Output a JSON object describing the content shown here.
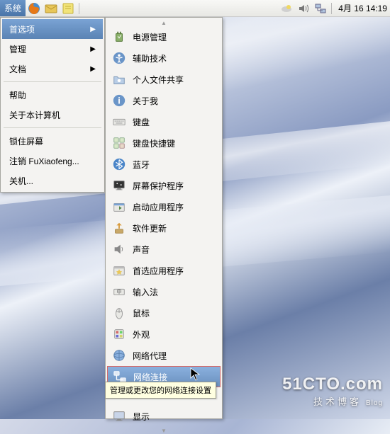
{
  "panel": {
    "system_label": "系统",
    "clock": "4月 16 14:19"
  },
  "system_menu": {
    "preferences": "首选项",
    "administration": "管理",
    "documentation": "文档",
    "help": "帮助",
    "about": "关于本计算机",
    "lock": "锁住屏幕",
    "logout": "注销 FuXiaofeng...",
    "shutdown": "关机..."
  },
  "preferences_menu": {
    "items": [
      {
        "label": "电源管理"
      },
      {
        "label": "辅助技术"
      },
      {
        "label": "个人文件共享"
      },
      {
        "label": "关于我"
      },
      {
        "label": "键盘"
      },
      {
        "label": "键盘快捷键"
      },
      {
        "label": "蓝牙"
      },
      {
        "label": "屏幕保护程序"
      },
      {
        "label": "启动应用程序"
      },
      {
        "label": "软件更新"
      },
      {
        "label": "声音"
      },
      {
        "label": "首选应用程序"
      },
      {
        "label": "输入法"
      },
      {
        "label": "鼠标"
      },
      {
        "label": "外观"
      },
      {
        "label": "网络代理"
      },
      {
        "label": "网络连接"
      },
      {
        "label": "显示"
      }
    ]
  },
  "tooltip": {
    "text": "管理或更改您的网络连接设置"
  },
  "watermark": {
    "domain": "51CTO.com",
    "tagline": "技术博客",
    "sub": "Blog"
  }
}
